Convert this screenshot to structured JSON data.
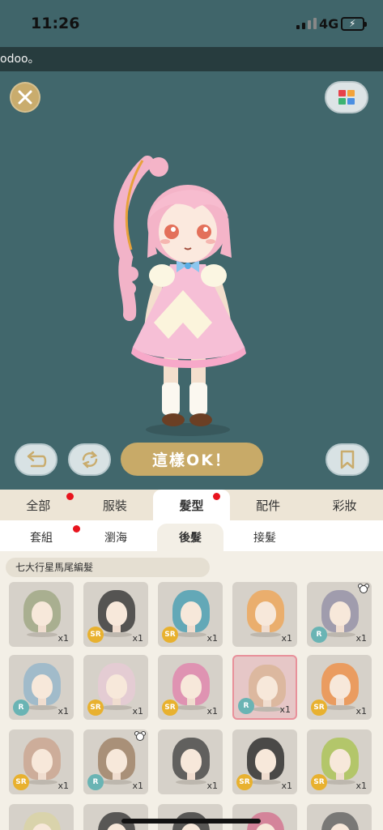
{
  "status": {
    "time": "11:26",
    "network": "4G",
    "battery_charging": true
  },
  "ticker": {
    "text": "odoo。"
  },
  "toolbar": {
    "ok_label": "這樣OK！"
  },
  "category_tabs": [
    {
      "label": "全部",
      "has_dot": true,
      "active": false
    },
    {
      "label": "服裝",
      "has_dot": false,
      "active": false
    },
    {
      "label": "髮型",
      "has_dot": true,
      "active": true
    },
    {
      "label": "配件",
      "has_dot": false,
      "active": false
    },
    {
      "label": "彩妝",
      "has_dot": false,
      "active": false
    }
  ],
  "sub_tabs": [
    {
      "label": "套組",
      "has_dot": true,
      "active": false
    },
    {
      "label": "瀏海",
      "has_dot": false,
      "active": false
    },
    {
      "label": "後髮",
      "has_dot": false,
      "active": true
    },
    {
      "label": "接髮",
      "has_dot": false,
      "active": false
    }
  ],
  "set_name": "七大行星馬尾編髮",
  "items": [
    {
      "rarity": "",
      "qty": "x1",
      "hair_color": "#9aa37c",
      "bear": false,
      "selected": false
    },
    {
      "rarity": "SR",
      "qty": "x1",
      "hair_color": "#2a2a2a",
      "bear": false,
      "selected": false
    },
    {
      "rarity": "SR",
      "qty": "x1",
      "hair_color": "#3c9ab0",
      "bear": false,
      "selected": false
    },
    {
      "rarity": "",
      "qty": "x1",
      "hair_color": "#f0a24e",
      "bear": false,
      "selected": false
    },
    {
      "rarity": "R",
      "qty": "x1",
      "hair_color": "#8d8aa3",
      "bear": true,
      "selected": false
    },
    {
      "rarity": "R",
      "qty": "x1",
      "hair_color": "#8fb3c9",
      "bear": false,
      "selected": false
    },
    {
      "rarity": "SR",
      "qty": "x1",
      "hair_color": "#e8c9d6",
      "bear": false,
      "selected": false
    },
    {
      "rarity": "SR",
      "qty": "x1",
      "hair_color": "#e27ea9",
      "bear": false,
      "selected": false
    },
    {
      "rarity": "R",
      "qty": "x1",
      "hair_color": "#d8b391",
      "bear": false,
      "selected": true
    },
    {
      "rarity": "SR",
      "qty": "x1",
      "hair_color": "#f08a3c",
      "bear": false,
      "selected": false
    },
    {
      "rarity": "SR",
      "qty": "x1",
      "hair_color": "#c9a08a",
      "bear": false,
      "selected": false
    },
    {
      "rarity": "R",
      "qty": "x1",
      "hair_color": "#9a7a5c",
      "bear": true,
      "selected": false
    },
    {
      "rarity": "",
      "qty": "x1",
      "hair_color": "#3a3a3a",
      "bear": false,
      "selected": false
    },
    {
      "rarity": "SR",
      "qty": "x1",
      "hair_color": "#1b1b1b",
      "bear": false,
      "selected": false
    },
    {
      "rarity": "SR",
      "qty": "x1",
      "hair_color": "#a7c14a",
      "bear": false,
      "selected": false
    },
    {
      "rarity": "",
      "qty": "",
      "hair_color": "#d9d3a0",
      "bear": false,
      "selected": false
    },
    {
      "rarity": "",
      "qty": "",
      "hair_color": "#2d2d2d",
      "bear": false,
      "selected": false
    },
    {
      "rarity": "",
      "qty": "",
      "hair_color": "#2d2d2d",
      "bear": false,
      "selected": false
    },
    {
      "rarity": "",
      "qty": "",
      "hair_color": "#d36a8a",
      "bear": false,
      "selected": false
    },
    {
      "rarity": "",
      "qty": "",
      "hair_color": "#5a5a5a",
      "bear": false,
      "selected": false
    }
  ]
}
